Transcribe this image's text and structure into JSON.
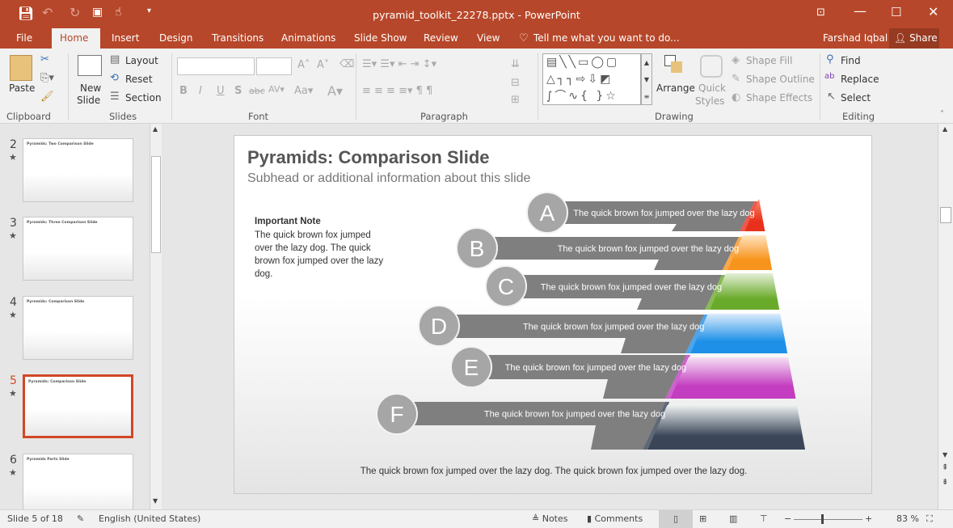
{
  "window": {
    "title": "pyramid_toolkit_22278.pptx - PowerPoint",
    "user": "Farshad Iqbal",
    "share": "Share"
  },
  "tabs": [
    "File",
    "Home",
    "Insert",
    "Design",
    "Transitions",
    "Animations",
    "Slide Show",
    "Review",
    "View"
  ],
  "active_tab": "Home",
  "tell_me": "Tell me what you want to do...",
  "ribbon": {
    "clipboard": {
      "paste": "Paste",
      "label": "Clipboard"
    },
    "slides": {
      "new_slide_1": "New",
      "new_slide_2": "Slide",
      "layout": "Layout",
      "reset": "Reset",
      "section": "Section",
      "label": "Slides"
    },
    "font": {
      "label": "Font"
    },
    "paragraph": {
      "label": "Paragraph"
    },
    "drawing": {
      "arrange": "Arrange",
      "quick_styles_1": "Quick",
      "quick_styles_2": "Styles",
      "shape_fill": "Shape Fill",
      "shape_outline": "Shape Outline",
      "shape_effects": "Shape Effects",
      "label": "Drawing"
    },
    "editing": {
      "find": "Find",
      "replace": "Replace",
      "select": "Select",
      "label": "Editing"
    }
  },
  "thumbnails": [
    {
      "num": "2",
      "title": "Pyramids: Two Comparison Slide"
    },
    {
      "num": "3",
      "title": "Pyramids: Three Comparison Slide"
    },
    {
      "num": "4",
      "title": "Pyramids: Comparison Slide"
    },
    {
      "num": "5",
      "title": "Pyramids: Comparison Slide",
      "selected": true
    },
    {
      "num": "6",
      "title": "Pyramids Parts Slide"
    }
  ],
  "slide": {
    "title": "Pyramids: Comparison Slide",
    "subtitle": "Subhead or additional information about this slide",
    "note_heading": "Important Note",
    "note_body": "The quick brown fox jumped over the lazy dog. The quick brown fox jumped over the lazy dog.",
    "footer": "The quick brown fox jumped over the lazy dog. The quick brown fox jumped over the lazy dog.",
    "levels": [
      {
        "letter": "A",
        "text": "The quick brown fox jumped over the lazy dog",
        "color": "#e8301c",
        "light": "#ff8a6a"
      },
      {
        "letter": "B",
        "text": "The quick brown fox jumped over the lazy dog",
        "color": "#f7941d",
        "light": "#ffe3c0"
      },
      {
        "letter": "C",
        "text": "The quick brown fox jumped over the lazy dog",
        "color": "#6aaa2a",
        "light": "#e4f0d8"
      },
      {
        "letter": "D",
        "text": "The quick brown fox jumped over the lazy dog",
        "color": "#1e90e8",
        "light": "#dcecfb"
      },
      {
        "letter": "E",
        "text": "The quick brown fox jumped over the lazy dog",
        "color": "#c23dc0",
        "light": "#f6e0f4"
      },
      {
        "letter": "F",
        "text": "The quick brown fox jumped over the lazy dog",
        "color": "#3a4658",
        "light": "#eef2f2"
      }
    ]
  },
  "status": {
    "slide": "Slide 5 of 18",
    "language": "English (United States)",
    "notes": "Notes",
    "comments": "Comments",
    "zoom": "83 %",
    "zoom_percent": 83
  }
}
